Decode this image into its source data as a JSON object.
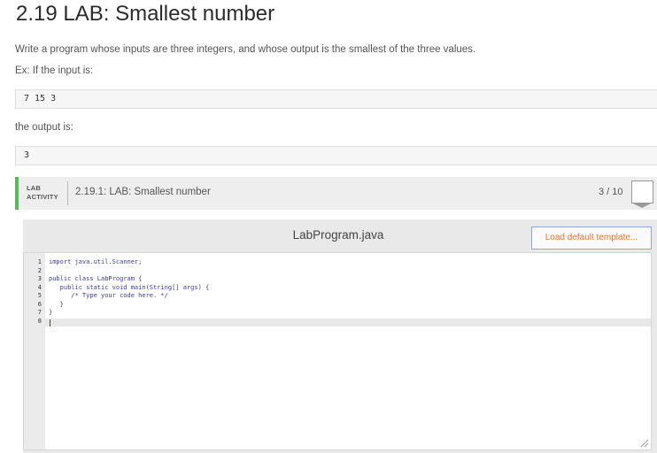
{
  "page_title": "2.19 LAB: Smallest number",
  "description": "Write a program whose inputs are three integers, and whose output is the smallest of the three values.",
  "example_intro": "Ex: If the input is:",
  "example_input": "7 15 3",
  "output_intro": "the output is:",
  "example_output": "3",
  "activity": {
    "tag_line1": "LAB",
    "tag_line2": "ACTIVITY",
    "name": "2.19.1: LAB: Smallest number",
    "score": "3 / 10",
    "accent_color": "#5cb85c"
  },
  "editor": {
    "file_name": "LabProgram.java",
    "load_button": "Load default template...",
    "line_numbers": [
      "1",
      "2",
      "3",
      "4",
      "5",
      "6",
      "7",
      "8"
    ],
    "code_lines": [
      "import java.util.Scanner;",
      "",
      "public class LabProgram {",
      "   public static void main(String[] args) {",
      "      /* Type your code here. */",
      "   }",
      "}",
      ""
    ]
  }
}
